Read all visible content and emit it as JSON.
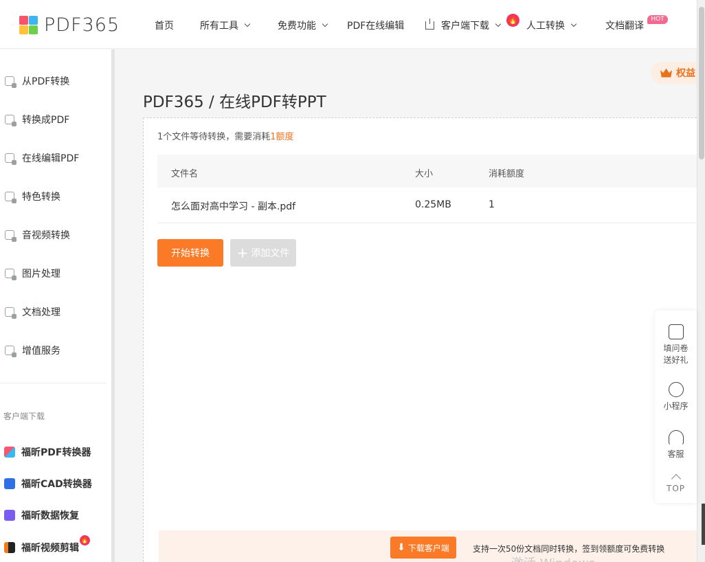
{
  "brand": {
    "name": "PDF365",
    "logo_colors": [
      "#f8536a",
      "#3bb6f0",
      "#ffc23a",
      "#6fcf4a"
    ]
  },
  "nav": {
    "home": "首页",
    "all_tools": "所有工具",
    "free_features": "免费功能",
    "pdf_edit_online": "PDF在线编辑",
    "client_download": "客户端下载",
    "manual_convert": "人工转换",
    "doc_translate": "文档翻译",
    "fire_badge": "🔥",
    "hot_badge": "HOT"
  },
  "sidebar": {
    "items": [
      {
        "label": "从PDF转换",
        "icon": "pdf-from-icon"
      },
      {
        "label": "转换成PDF",
        "icon": "pdf-to-icon"
      },
      {
        "label": "在线编辑PDF",
        "icon": "edit-pdf-icon"
      },
      {
        "label": "特色转换",
        "icon": "feature-shield-icon"
      },
      {
        "label": "音视频转换",
        "icon": "media-convert-icon"
      },
      {
        "label": "图片处理",
        "icon": "image-process-icon"
      },
      {
        "label": "文档处理",
        "icon": "document-icon"
      },
      {
        "label": "增值服务",
        "icon": "list-service-icon"
      }
    ],
    "section_title": "客户端下载",
    "apps": [
      {
        "label": "福昕PDF转换器",
        "color": "#f6576e"
      },
      {
        "label": "福昕CAD转换器",
        "color": "#2f6fe4"
      },
      {
        "label": "福昕数据恢复",
        "color": "#7a5cf0"
      },
      {
        "label": "福昕视频剪辑",
        "color": "#f07a1e"
      }
    ]
  },
  "benefit": {
    "label": "权益"
  },
  "main": {
    "title": "PDF365 / 在线PDF转PPT",
    "notice_prefix": "1个文件等待转换，需要消耗",
    "notice_highlight": "1额度",
    "columns": {
      "name": "文件名",
      "size": "大小",
      "cost": "消耗额度"
    },
    "rows": [
      {
        "name": "怎么面对高中学习 - 副本.pdf",
        "size": "0.25MB",
        "cost": "1"
      }
    ],
    "start_button": "开始转换",
    "add_button": "添加文件"
  },
  "float_tools": {
    "survey_line1": "填问卷",
    "survey_line2": "送好礼",
    "mini_program": "小程序",
    "support": "客服",
    "top": "TOP"
  },
  "bottom_bar": {
    "download_button": "下载客户端",
    "text": "支持一次50份文档同时转换，签到领额度可免费转换"
  },
  "watermark": "激活 Windows",
  "colors": {
    "accent": "#fb7a28",
    "highlight": "#f07020"
  }
}
